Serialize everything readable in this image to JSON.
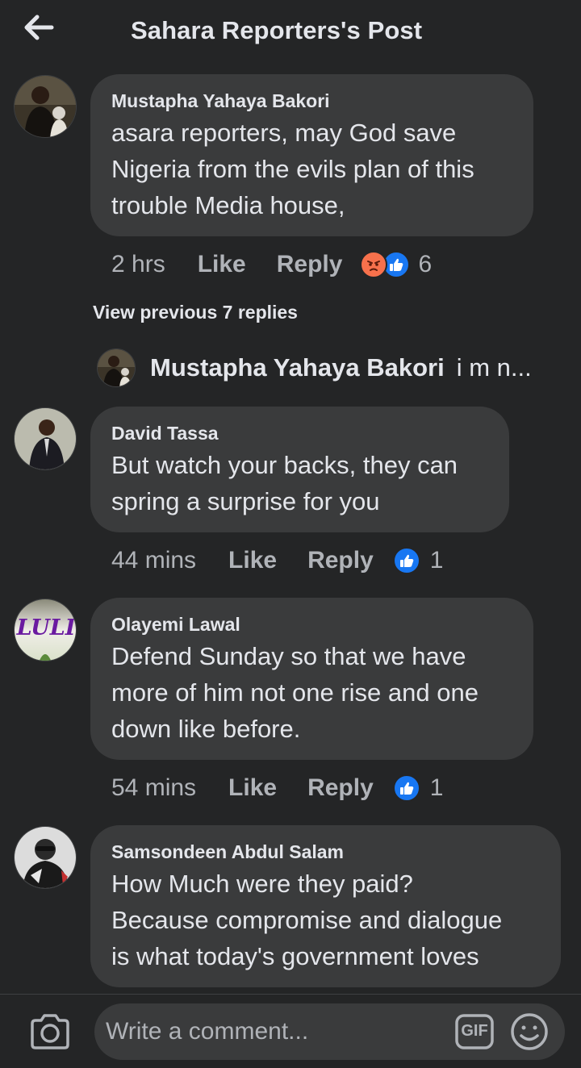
{
  "header": {
    "title": "Sahara Reporters's Post",
    "back_icon": "arrow-left-icon"
  },
  "comments": [
    {
      "author": "Mustapha Yahaya Bakori",
      "text_lines": [
        "asara reporters, may God save",
        "Nigeria from the evils plan of this",
        "trouble Media house,"
      ],
      "time": "2 hrs",
      "like_label": "Like",
      "reply_label": "Reply",
      "reactions": [
        "angry-icon",
        "like-icon"
      ],
      "reaction_count": "6"
    },
    {
      "author": "David Tassa",
      "text_lines": [
        "But watch your backs, they can",
        "spring a surprise for you"
      ],
      "time": "44 mins",
      "like_label": "Like",
      "reply_label": "Reply",
      "reactions": [
        "like-icon"
      ],
      "reaction_count": "1"
    },
    {
      "author": "Olayemi Lawal",
      "avatar_text": "LULI",
      "text_lines": [
        "Defend Sunday so that we have",
        "more of him not one rise and one",
        "down like before."
      ],
      "time": "54 mins",
      "like_label": "Like",
      "reply_label": "Reply",
      "reactions": [
        "like-icon"
      ],
      "reaction_count": "1"
    },
    {
      "author": "Samsondeen Abdul Salam",
      "text_lines": [
        "How Much were they paid?",
        "Because compromise and dialogue",
        "is what today's government loves"
      ]
    }
  ],
  "replies_thread": {
    "view_previous": "View previous 7 replies",
    "latest_reply_author": "Mustapha Yahaya Bakori",
    "latest_reply_snippet": "i m n..."
  },
  "composer": {
    "placeholder": "Write a comment...",
    "camera_icon": "camera-icon",
    "gif_label": "GIF",
    "emoji_icon": "emoji-icon"
  },
  "colors": {
    "background": "#242526",
    "bubble": "#3a3b3c",
    "text_primary": "#e4e6eb",
    "text_secondary": "#b0b3b8",
    "like_blue": "#1877f2",
    "angry_orange": "#f7714c"
  }
}
